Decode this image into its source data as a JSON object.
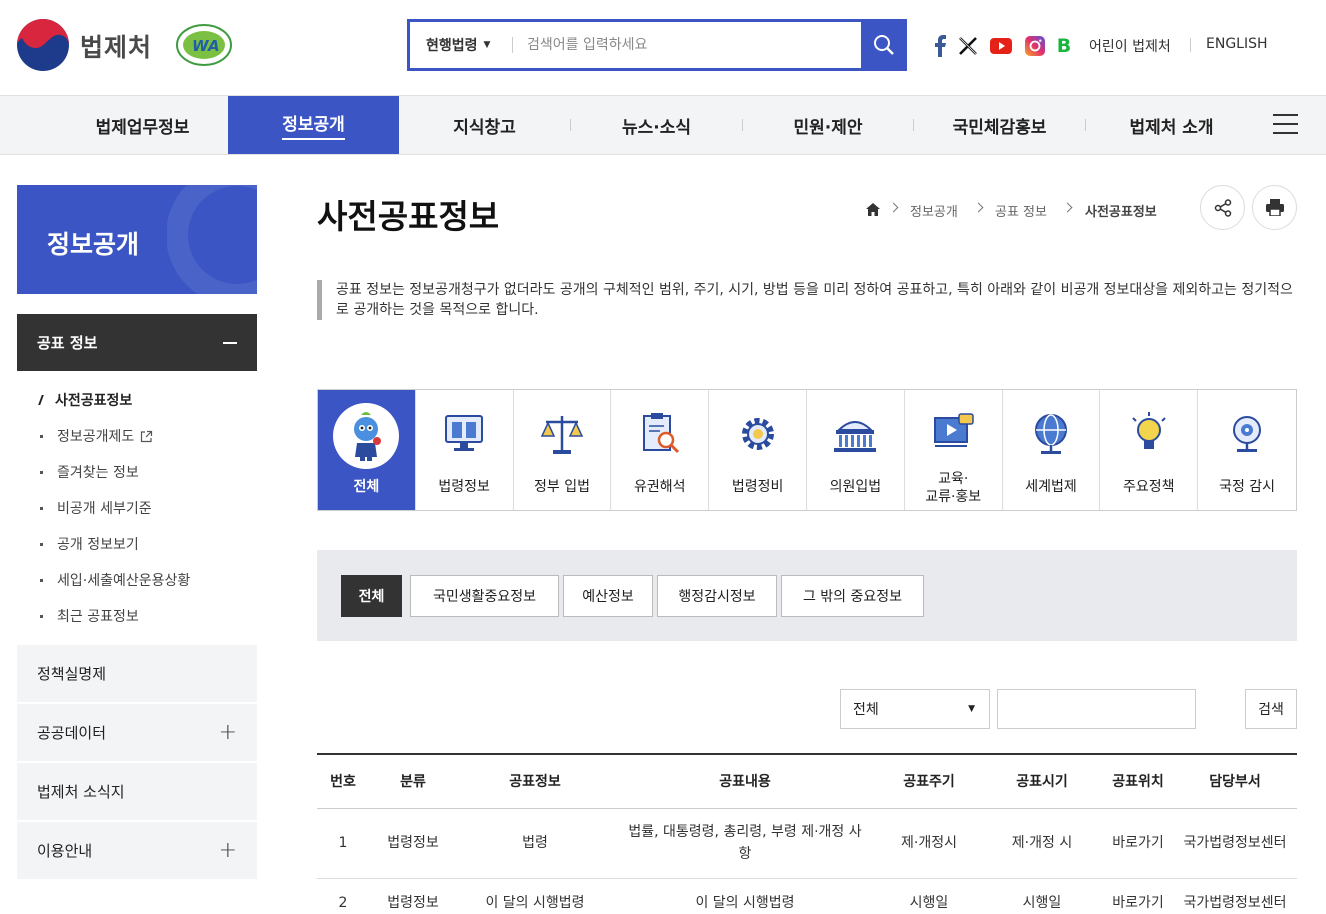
{
  "header": {
    "logo_text": "법제처",
    "badge_text": "WA",
    "search": {
      "category": "현행법령",
      "placeholder": "검색어를 입력하세요"
    },
    "links": {
      "kids": "어린이 법제처",
      "english": "ENGLISH"
    },
    "social": [
      "facebook-icon",
      "x-icon",
      "youtube-icon",
      "instagram-icon",
      "blog-icon"
    ]
  },
  "gnb": [
    "법제업무정보",
    "정보공개",
    "지식창고",
    "뉴스·소식",
    "민원·제안",
    "국민체감홍보",
    "법제처 소개"
  ],
  "sidebar": {
    "title": "정보공개",
    "open_menu": "공표 정보",
    "sub_items": [
      "사전공표정보",
      "정보공개제도",
      "즐겨찾는 정보",
      "비공개 세부기준",
      "공개 정보보기",
      "세입·세출예산운용상황",
      "최근 공표정보"
    ],
    "menus": [
      "정책실명제",
      "공공데이터",
      "법제처 소식지",
      "이용안내"
    ]
  },
  "main": {
    "title": "사전공표정보",
    "breadcrumb": [
      "정보공개",
      "공표 정보",
      "사전공표정보"
    ],
    "description": "공표 정보는 정보공개청구가 없더라도 공개의 구체적인 범위, 주기, 시기, 방법 등을 미리 정하여 공표하고, 특히 아래와 같이 비공개 정보대상을 제외하고는 정기적으로 공개하는 것을 목적으로 합니다.",
    "categories": [
      "전체",
      "법령정보",
      "정부 입법",
      "유권해석",
      "법령정비",
      "의원입법",
      "교육·",
      "교류·홍보",
      "세계법제",
      "주요정책",
      "국정 감시"
    ],
    "tabs": [
      "전체",
      "국민생활중요정보",
      "예산정보",
      "행정감시정보",
      "그 밖의 중요정보"
    ],
    "filter": {
      "select": "전체",
      "button": "검색"
    },
    "table": {
      "headers": [
        "번호",
        "분류",
        "공표정보",
        "공표내용",
        "공표주기",
        "공표시기",
        "공표위치",
        "담당부서"
      ],
      "rows": [
        [
          "1",
          "법령정보",
          "법령",
          "법률, 대통령령, 총리령, 부령 제·개정 사항",
          "제·개정시",
          "제·개정 시",
          "바로가기",
          "국가법령정보센터"
        ],
        [
          "2",
          "법령정보",
          "이 달의 시행법령",
          "이 달의 시행법령",
          "시행일",
          "시행일",
          "바로가기",
          "국가법령정보센터"
        ]
      ]
    }
  },
  "colors": {
    "primary": "#3b56c4",
    "dark": "#333333",
    "panel": "#e8eaee"
  }
}
